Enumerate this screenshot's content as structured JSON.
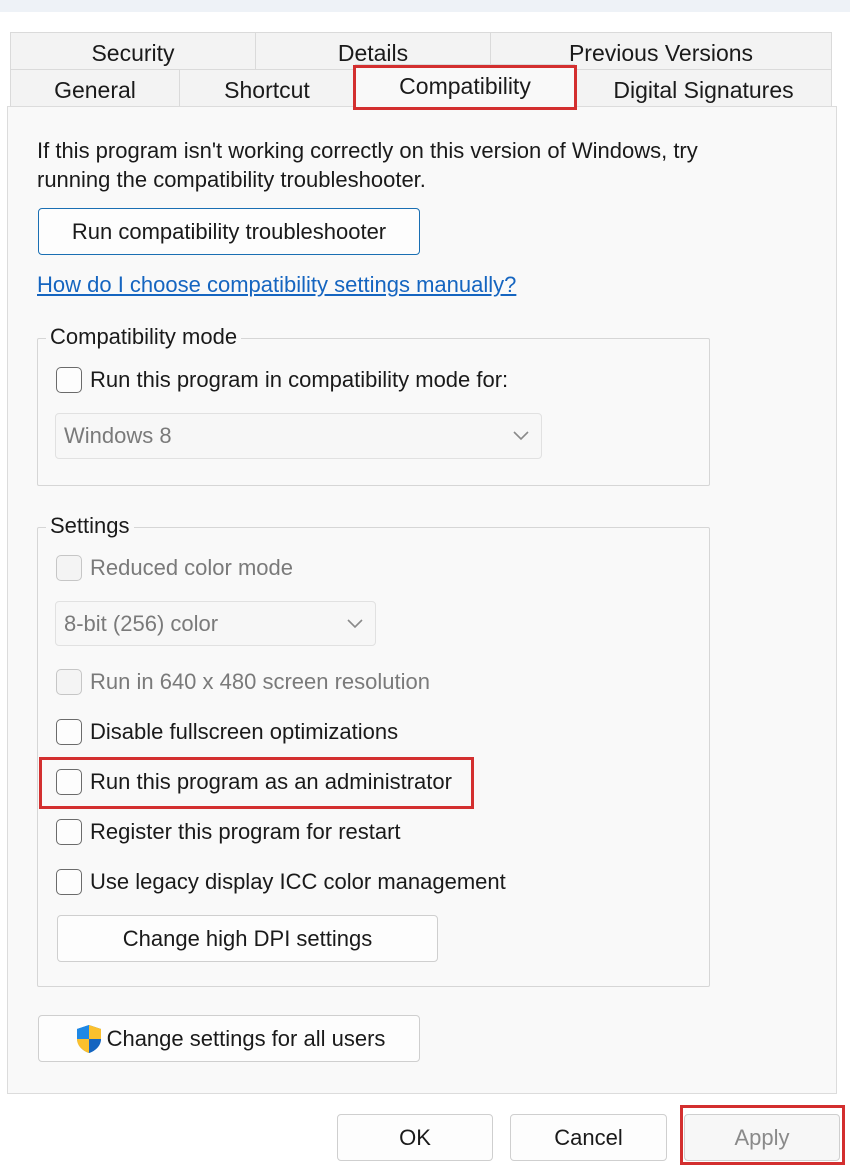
{
  "tabs": {
    "row1": [
      "Security",
      "Details",
      "Previous Versions"
    ],
    "row2": [
      "General",
      "Shortcut",
      "Compatibility",
      "Digital Signatures"
    ],
    "selected": "Compatibility"
  },
  "intro": {
    "line1": "If this program isn't working correctly on this version of Windows, try",
    "line2": "running the compatibility troubleshooter."
  },
  "troubleshooter_button": "Run compatibility troubleshooter",
  "help_link": "How do I choose compatibility settings manually? ",
  "compat_mode": {
    "label": "Compatibility mode",
    "checkbox_label": "Run this program in compatibility mode for:",
    "selected_os": "Windows 8"
  },
  "settings": {
    "label": "Settings",
    "reduced_color": "Reduced color mode",
    "color_option": "8-bit (256) color",
    "resolution": "Run in 640 x 480 screen resolution",
    "fullscreen": "Disable fullscreen optimizations",
    "admin": "Run this program as an administrator",
    "restart": "Register this program for restart",
    "icc": "Use legacy display ICC color management",
    "dpi_button": "Change high DPI settings"
  },
  "all_users_button": "Change settings for all users",
  "footer": {
    "ok": "OK",
    "cancel": "Cancel",
    "apply": "Apply"
  },
  "colors": {
    "highlight": "#d32f2f",
    "link": "#1565c0",
    "accent_border": "#1a6fb3"
  }
}
